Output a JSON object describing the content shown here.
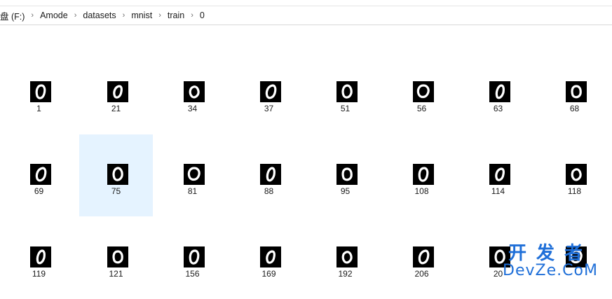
{
  "breadcrumb": {
    "items": [
      "盘 (F:)",
      "Amode",
      "datasets",
      "mnist",
      "train",
      "0"
    ],
    "separator": "›"
  },
  "files": [
    {
      "name": "1"
    },
    {
      "name": "21"
    },
    {
      "name": "34"
    },
    {
      "name": "37"
    },
    {
      "name": "51"
    },
    {
      "name": "56"
    },
    {
      "name": "63"
    },
    {
      "name": "68"
    },
    {
      "name": "69"
    },
    {
      "name": "75",
      "selected": true
    },
    {
      "name": "81"
    },
    {
      "name": "88"
    },
    {
      "name": "95"
    },
    {
      "name": "108"
    },
    {
      "name": "114"
    },
    {
      "name": "118"
    },
    {
      "name": "119"
    },
    {
      "name": "121"
    },
    {
      "name": "156"
    },
    {
      "name": "169"
    },
    {
      "name": "192"
    },
    {
      "name": "206"
    },
    {
      "name": "20"
    },
    {
      "name": ""
    }
  ],
  "thumbnail_icon": "handwritten-zero-thumbnail",
  "colors": {
    "selection": "#e5f3ff",
    "thumbnail_bg": "#000000",
    "thumbnail_stroke": "#ffffff",
    "watermark": "#1f6fd8"
  },
  "watermark": {
    "line1": "开发者",
    "line2": "DevZe.CoM"
  }
}
